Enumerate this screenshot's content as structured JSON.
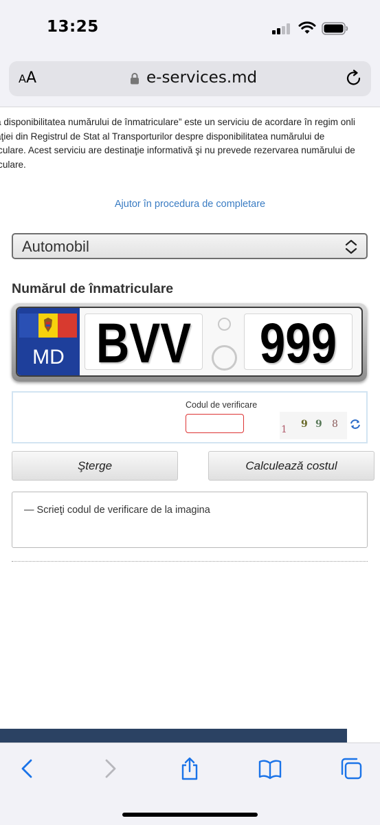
{
  "status_bar": {
    "time": "13:25"
  },
  "browser": {
    "aa_label_small": "A",
    "aa_label_large": "A",
    "url": "e-services.md"
  },
  "page": {
    "intro_lines": [
      "ă disponibilitatea numărului de înmatriculare” este un serviciu de acordare în regim onli",
      "aţiei din Registrul de Stat al Transporturilor despre disponibilitatea numărului de",
      "iculare. Acest serviciu are destinaţie informativă şi nu prevede rezervarea numărului de",
      "iculare."
    ],
    "help_link": "Ajutor în procedura de completare",
    "vehicle_type": {
      "selected": "Automobil"
    },
    "plate_section_label": "Numărul de înmatriculare",
    "plate": {
      "country_code": "MD",
      "letters": "BVV",
      "digits": "999"
    },
    "captcha": {
      "label": "Codul de verificare",
      "input_value": "",
      "image_chars": [
        "1",
        "9",
        "9",
        "8"
      ]
    },
    "buttons": {
      "clear": "Şterge",
      "calculate": "Calculează costul"
    },
    "message": "— Scrieţi codul de verificare de la imagina"
  },
  "colors": {
    "link": "#3a7cc3",
    "plate_band": "#1e3f9b",
    "footer_strip": "#2b4263",
    "ios_blue": "#1a73e8"
  },
  "toolbar_icons": [
    "back-icon",
    "forward-icon",
    "share-icon",
    "bookmarks-icon",
    "tabs-icon"
  ]
}
